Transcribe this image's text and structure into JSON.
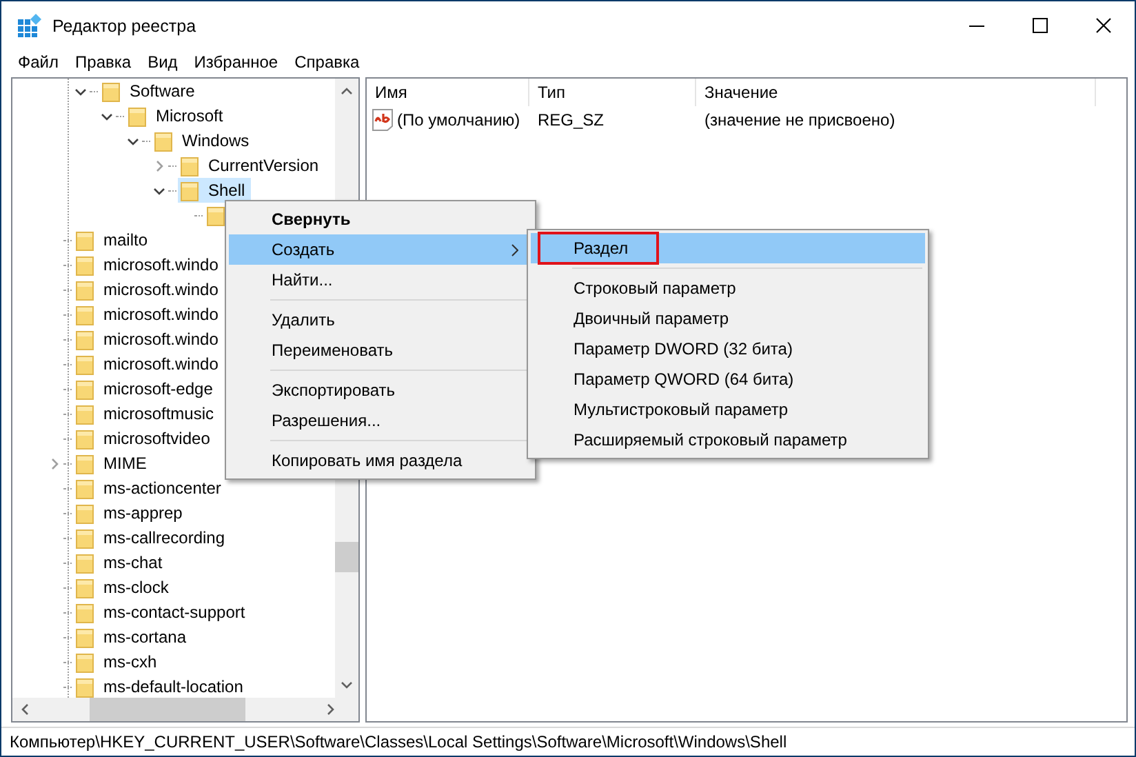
{
  "window": {
    "title": "Редактор реестра"
  },
  "menu_bar": [
    "Файл",
    "Правка",
    "Вид",
    "Избранное",
    "Справка"
  ],
  "tree": {
    "branch": [
      {
        "name": "Software",
        "expanded": true,
        "selected": false,
        "children": [
          {
            "name": "Microsoft",
            "expanded": true,
            "selected": false,
            "children": [
              {
                "name": "Windows",
                "expanded": true,
                "selected": false,
                "children": [
                  {
                    "name": "CurrentVersion",
                    "expanded": false,
                    "selected": false
                  },
                  {
                    "name": "Shell",
                    "expanded": true,
                    "selected": true,
                    "children": [
                      {
                        "selected": false
                      }
                    ]
                  }
                ]
              }
            ]
          }
        ]
      }
    ],
    "items": [
      {
        "name": "mailto",
        "selected": false
      },
      {
        "name": "microsoft.windo",
        "selected": false
      },
      {
        "name": "microsoft.windo",
        "selected": false
      },
      {
        "name": "microsoft.windo",
        "selected": false
      },
      {
        "name": "microsoft.windo",
        "selected": false
      },
      {
        "name": "microsoft.windo",
        "selected": false
      },
      {
        "name": "microsoft-edge",
        "selected": false
      },
      {
        "name": "microsoftmusic",
        "selected": false
      },
      {
        "name": "microsoftvideo",
        "selected": false
      },
      {
        "name": "MIME",
        "expanded": false,
        "selected": false
      },
      {
        "name": "ms-actioncenter",
        "selected": false
      },
      {
        "name": "ms-apprep",
        "selected": false
      },
      {
        "name": "ms-callrecording",
        "selected": false
      },
      {
        "name": "ms-chat",
        "selected": false
      },
      {
        "name": "ms-clock",
        "selected": false
      },
      {
        "name": "ms-contact-support",
        "selected": false
      },
      {
        "name": "ms-cortana",
        "selected": false
      },
      {
        "name": "ms-cxh",
        "selected": false
      },
      {
        "name": "ms-default-location",
        "selected": false
      }
    ]
  },
  "values": {
    "columns": [
      "Имя",
      "Тип",
      "Значение"
    ],
    "rows": [
      {
        "name": "(По умолчанию)",
        "type": "REG_SZ",
        "data": "(значение не присвоено)",
        "selected": false
      }
    ]
  },
  "context_menu": {
    "items": [
      {
        "kind": "item",
        "label": "Свернуть",
        "default": true,
        "selected": false
      },
      {
        "kind": "item",
        "label": "Создать",
        "submenu": true,
        "selected": true
      },
      {
        "kind": "item",
        "label": "Найти...",
        "selected": false
      },
      {
        "kind": "separator"
      },
      {
        "kind": "item",
        "label": "Удалить",
        "selected": false
      },
      {
        "kind": "item",
        "label": "Переименовать",
        "selected": false
      },
      {
        "kind": "separator"
      },
      {
        "kind": "item",
        "label": "Экспортировать",
        "selected": false
      },
      {
        "kind": "item",
        "label": "Разрешения...",
        "selected": false
      },
      {
        "kind": "separator"
      },
      {
        "kind": "item",
        "label": "Копировать имя раздела",
        "selected": false
      }
    ],
    "submenu": {
      "items": [
        {
          "kind": "item",
          "label": "Раздел",
          "selected": true,
          "outlined": true
        },
        {
          "kind": "separator"
        },
        {
          "kind": "item",
          "label": "Строковый параметр",
          "selected": false
        },
        {
          "kind": "item",
          "label": "Двоичный параметр",
          "selected": false
        },
        {
          "kind": "item",
          "label": "Параметр DWORD (32 бита)",
          "selected": false
        },
        {
          "kind": "item",
          "label": "Параметр QWORD (64 бита)",
          "selected": false
        },
        {
          "kind": "item",
          "label": "Мультистроковый параметр",
          "selected": false
        },
        {
          "kind": "item",
          "label": "Расширяемый строковый параметр",
          "selected": false
        }
      ]
    }
  },
  "status_bar": {
    "path": "Компьютер\\HKEY_CURRENT_USER\\Software\\Classes\\Local Settings\\Software\\Microsoft\\Windows\\Shell"
  }
}
